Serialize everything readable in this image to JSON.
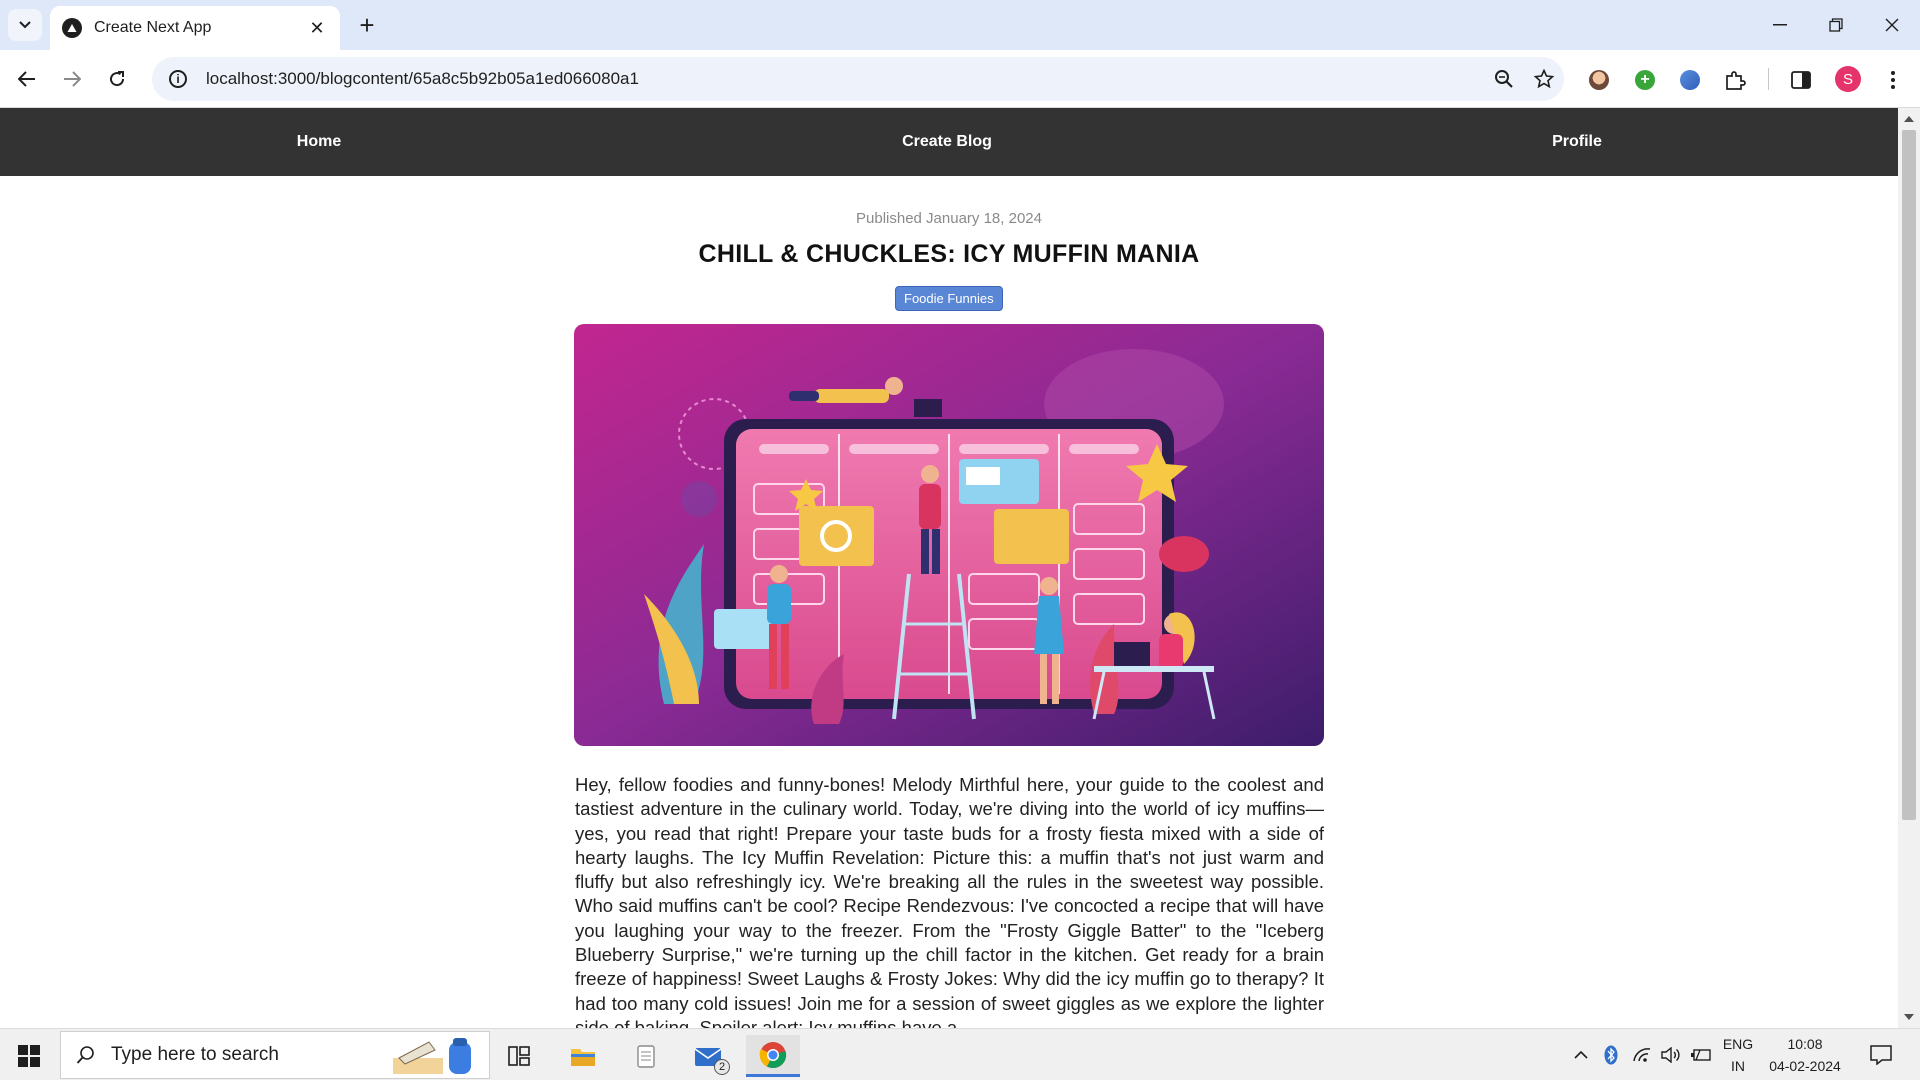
{
  "browser": {
    "tab_title": "Create Next App",
    "url": "localhost:3000/blogcontent/65a8c5b92b05a1ed066080a1",
    "profile_initial": "S"
  },
  "nav": {
    "home": "Home",
    "create_blog": "Create Blog",
    "profile": "Profile"
  },
  "post": {
    "published": "Published January 18, 2024",
    "title": "CHILL & CHUCKLES: ICY MUFFIN MANIA",
    "category": "Foodie Funnies",
    "body": "Hey, fellow foodies and funny-bones! Melody Mirthful here, your guide to the coolest and tastiest adventure in the culinary world. Today, we're diving into the world of icy muffins—yes, you read that right! Prepare your taste buds for a frosty fiesta mixed with a side of hearty laughs. The Icy Muffin Revelation: Picture this: a muffin that's not just warm and fluffy but also refreshingly icy. We're breaking all the rules in the sweetest way possible. Who said muffins can't be cool? Recipe Rendezvous: I've concocted a recipe that will have you laughing your way to the freezer. From the \"Frosty Giggle Batter\" to the \"Iceberg Blueberry Surprise,\" we're turning up the chill factor in the kitchen. Get ready for a brain freeze of happiness! Sweet Laughs & Frosty Jokes: Why did the icy muffin go to therapy? It had too many cold issues! Join me for a session of sweet giggles as we explore the lighter side of baking. Spoiler alert: Icy muffins have a"
  },
  "taskbar": {
    "search_placeholder": "Type here to search",
    "mail_badge": "2",
    "language": "ENG",
    "region": "IN",
    "time": "10:08",
    "date": "04-02-2024"
  },
  "colors": {
    "nav_bg": "#333333",
    "category_bg": "#5a86d6",
    "tabstrip_bg": "#dee8f8"
  }
}
